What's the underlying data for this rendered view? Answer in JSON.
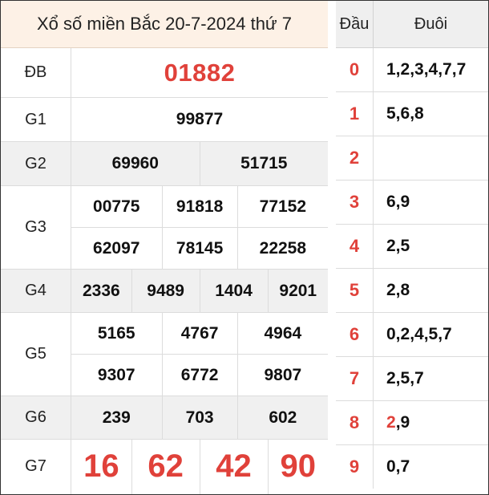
{
  "title": "Xổ số miền Bắc 20-7-2024 thứ 7",
  "prizes": {
    "db": {
      "label": "ĐB",
      "numbers": [
        "01882"
      ]
    },
    "g1": {
      "label": "G1",
      "numbers": [
        "99877"
      ]
    },
    "g2": {
      "label": "G2",
      "numbers": [
        "69960",
        "51715"
      ]
    },
    "g3": {
      "label": "G3",
      "numbers": [
        "00775",
        "91818",
        "77152",
        "62097",
        "78145",
        "22258"
      ]
    },
    "g4": {
      "label": "G4",
      "numbers": [
        "2336",
        "9489",
        "1404",
        "9201"
      ]
    },
    "g5": {
      "label": "G5",
      "numbers": [
        "5165",
        "4767",
        "4964",
        "9307",
        "6772",
        "9807"
      ]
    },
    "g6": {
      "label": "G6",
      "numbers": [
        "239",
        "703",
        "602"
      ]
    },
    "g7": {
      "label": "G7",
      "numbers": [
        "16",
        "62",
        "42",
        "90"
      ]
    }
  },
  "loto": {
    "head_label": "Đầu",
    "tail_label": "Đuôi",
    "rows": [
      {
        "head": "0",
        "tails": "1,2,3,4,7,7"
      },
      {
        "head": "1",
        "tails": "5,6,8"
      },
      {
        "head": "2",
        "tails": ""
      },
      {
        "head": "3",
        "tails": "6,9"
      },
      {
        "head": "4",
        "tails": "2,5"
      },
      {
        "head": "5",
        "tails": "2,8"
      },
      {
        "head": "6",
        "tails": "0,2,4,5,7"
      },
      {
        "head": "7",
        "tails": "2,5,7"
      },
      {
        "head": "8",
        "tails_highlight": "2",
        "tails_rest": ",9"
      },
      {
        "head": "9",
        "tails": "0,7"
      }
    ]
  },
  "colors": {
    "accent_red": "#e0413a",
    "title_bg": "#fdf1e6",
    "alt_row_bg": "#f0f0f0"
  }
}
